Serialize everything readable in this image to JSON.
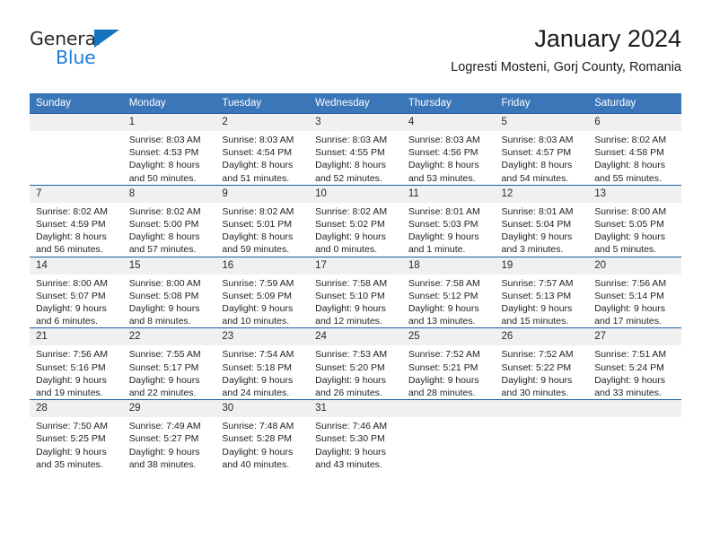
{
  "brand": {
    "name_part1": "General",
    "name_part2": "Blue",
    "triangle_color": "#1572bd",
    "blue_color": "#1b7fd4"
  },
  "header": {
    "title": "January 2024",
    "subtitle": "Logresti Mosteni, Gorj County, Romania"
  },
  "theme": {
    "header_blue": "#3b76b8",
    "row_border_blue": "#1c5ea0",
    "daynum_band": "#f0f0f0"
  },
  "weekdays": [
    "Sunday",
    "Monday",
    "Tuesday",
    "Wednesday",
    "Thursday",
    "Friday",
    "Saturday"
  ],
  "weeks": [
    [
      {
        "day": "",
        "sunrise": "",
        "sunset": "",
        "daylight1": "",
        "daylight2": ""
      },
      {
        "day": "1",
        "sunrise": "Sunrise: 8:03 AM",
        "sunset": "Sunset: 4:53 PM",
        "daylight1": "Daylight: 8 hours",
        "daylight2": "and 50 minutes."
      },
      {
        "day": "2",
        "sunrise": "Sunrise: 8:03 AM",
        "sunset": "Sunset: 4:54 PM",
        "daylight1": "Daylight: 8 hours",
        "daylight2": "and 51 minutes."
      },
      {
        "day": "3",
        "sunrise": "Sunrise: 8:03 AM",
        "sunset": "Sunset: 4:55 PM",
        "daylight1": "Daylight: 8 hours",
        "daylight2": "and 52 minutes."
      },
      {
        "day": "4",
        "sunrise": "Sunrise: 8:03 AM",
        "sunset": "Sunset: 4:56 PM",
        "daylight1": "Daylight: 8 hours",
        "daylight2": "and 53 minutes."
      },
      {
        "day": "5",
        "sunrise": "Sunrise: 8:03 AM",
        "sunset": "Sunset: 4:57 PM",
        "daylight1": "Daylight: 8 hours",
        "daylight2": "and 54 minutes."
      },
      {
        "day": "6",
        "sunrise": "Sunrise: 8:02 AM",
        "sunset": "Sunset: 4:58 PM",
        "daylight1": "Daylight: 8 hours",
        "daylight2": "and 55 minutes."
      }
    ],
    [
      {
        "day": "7",
        "sunrise": "Sunrise: 8:02 AM",
        "sunset": "Sunset: 4:59 PM",
        "daylight1": "Daylight: 8 hours",
        "daylight2": "and 56 minutes."
      },
      {
        "day": "8",
        "sunrise": "Sunrise: 8:02 AM",
        "sunset": "Sunset: 5:00 PM",
        "daylight1": "Daylight: 8 hours",
        "daylight2": "and 57 minutes."
      },
      {
        "day": "9",
        "sunrise": "Sunrise: 8:02 AM",
        "sunset": "Sunset: 5:01 PM",
        "daylight1": "Daylight: 8 hours",
        "daylight2": "and 59 minutes."
      },
      {
        "day": "10",
        "sunrise": "Sunrise: 8:02 AM",
        "sunset": "Sunset: 5:02 PM",
        "daylight1": "Daylight: 9 hours",
        "daylight2": "and 0 minutes."
      },
      {
        "day": "11",
        "sunrise": "Sunrise: 8:01 AM",
        "sunset": "Sunset: 5:03 PM",
        "daylight1": "Daylight: 9 hours",
        "daylight2": "and 1 minute."
      },
      {
        "day": "12",
        "sunrise": "Sunrise: 8:01 AM",
        "sunset": "Sunset: 5:04 PM",
        "daylight1": "Daylight: 9 hours",
        "daylight2": "and 3 minutes."
      },
      {
        "day": "13",
        "sunrise": "Sunrise: 8:00 AM",
        "sunset": "Sunset: 5:05 PM",
        "daylight1": "Daylight: 9 hours",
        "daylight2": "and 5 minutes."
      }
    ],
    [
      {
        "day": "14",
        "sunrise": "Sunrise: 8:00 AM",
        "sunset": "Sunset: 5:07 PM",
        "daylight1": "Daylight: 9 hours",
        "daylight2": "and 6 minutes."
      },
      {
        "day": "15",
        "sunrise": "Sunrise: 8:00 AM",
        "sunset": "Sunset: 5:08 PM",
        "daylight1": "Daylight: 9 hours",
        "daylight2": "and 8 minutes."
      },
      {
        "day": "16",
        "sunrise": "Sunrise: 7:59 AM",
        "sunset": "Sunset: 5:09 PM",
        "daylight1": "Daylight: 9 hours",
        "daylight2": "and 10 minutes."
      },
      {
        "day": "17",
        "sunrise": "Sunrise: 7:58 AM",
        "sunset": "Sunset: 5:10 PM",
        "daylight1": "Daylight: 9 hours",
        "daylight2": "and 12 minutes."
      },
      {
        "day": "18",
        "sunrise": "Sunrise: 7:58 AM",
        "sunset": "Sunset: 5:12 PM",
        "daylight1": "Daylight: 9 hours",
        "daylight2": "and 13 minutes."
      },
      {
        "day": "19",
        "sunrise": "Sunrise: 7:57 AM",
        "sunset": "Sunset: 5:13 PM",
        "daylight1": "Daylight: 9 hours",
        "daylight2": "and 15 minutes."
      },
      {
        "day": "20",
        "sunrise": "Sunrise: 7:56 AM",
        "sunset": "Sunset: 5:14 PM",
        "daylight1": "Daylight: 9 hours",
        "daylight2": "and 17 minutes."
      }
    ],
    [
      {
        "day": "21",
        "sunrise": "Sunrise: 7:56 AM",
        "sunset": "Sunset: 5:16 PM",
        "daylight1": "Daylight: 9 hours",
        "daylight2": "and 19 minutes."
      },
      {
        "day": "22",
        "sunrise": "Sunrise: 7:55 AM",
        "sunset": "Sunset: 5:17 PM",
        "daylight1": "Daylight: 9 hours",
        "daylight2": "and 22 minutes."
      },
      {
        "day": "23",
        "sunrise": "Sunrise: 7:54 AM",
        "sunset": "Sunset: 5:18 PM",
        "daylight1": "Daylight: 9 hours",
        "daylight2": "and 24 minutes."
      },
      {
        "day": "24",
        "sunrise": "Sunrise: 7:53 AM",
        "sunset": "Sunset: 5:20 PM",
        "daylight1": "Daylight: 9 hours",
        "daylight2": "and 26 minutes."
      },
      {
        "day": "25",
        "sunrise": "Sunrise: 7:52 AM",
        "sunset": "Sunset: 5:21 PM",
        "daylight1": "Daylight: 9 hours",
        "daylight2": "and 28 minutes."
      },
      {
        "day": "26",
        "sunrise": "Sunrise: 7:52 AM",
        "sunset": "Sunset: 5:22 PM",
        "daylight1": "Daylight: 9 hours",
        "daylight2": "and 30 minutes."
      },
      {
        "day": "27",
        "sunrise": "Sunrise: 7:51 AM",
        "sunset": "Sunset: 5:24 PM",
        "daylight1": "Daylight: 9 hours",
        "daylight2": "and 33 minutes."
      }
    ],
    [
      {
        "day": "28",
        "sunrise": "Sunrise: 7:50 AM",
        "sunset": "Sunset: 5:25 PM",
        "daylight1": "Daylight: 9 hours",
        "daylight2": "and 35 minutes."
      },
      {
        "day": "29",
        "sunrise": "Sunrise: 7:49 AM",
        "sunset": "Sunset: 5:27 PM",
        "daylight1": "Daylight: 9 hours",
        "daylight2": "and 38 minutes."
      },
      {
        "day": "30",
        "sunrise": "Sunrise: 7:48 AM",
        "sunset": "Sunset: 5:28 PM",
        "daylight1": "Daylight: 9 hours",
        "daylight2": "and 40 minutes."
      },
      {
        "day": "31",
        "sunrise": "Sunrise: 7:46 AM",
        "sunset": "Sunset: 5:30 PM",
        "daylight1": "Daylight: 9 hours",
        "daylight2": "and 43 minutes."
      },
      {
        "day": "",
        "sunrise": "",
        "sunset": "",
        "daylight1": "",
        "daylight2": ""
      },
      {
        "day": "",
        "sunrise": "",
        "sunset": "",
        "daylight1": "",
        "daylight2": ""
      },
      {
        "day": "",
        "sunrise": "",
        "sunset": "",
        "daylight1": "",
        "daylight2": ""
      }
    ]
  ]
}
